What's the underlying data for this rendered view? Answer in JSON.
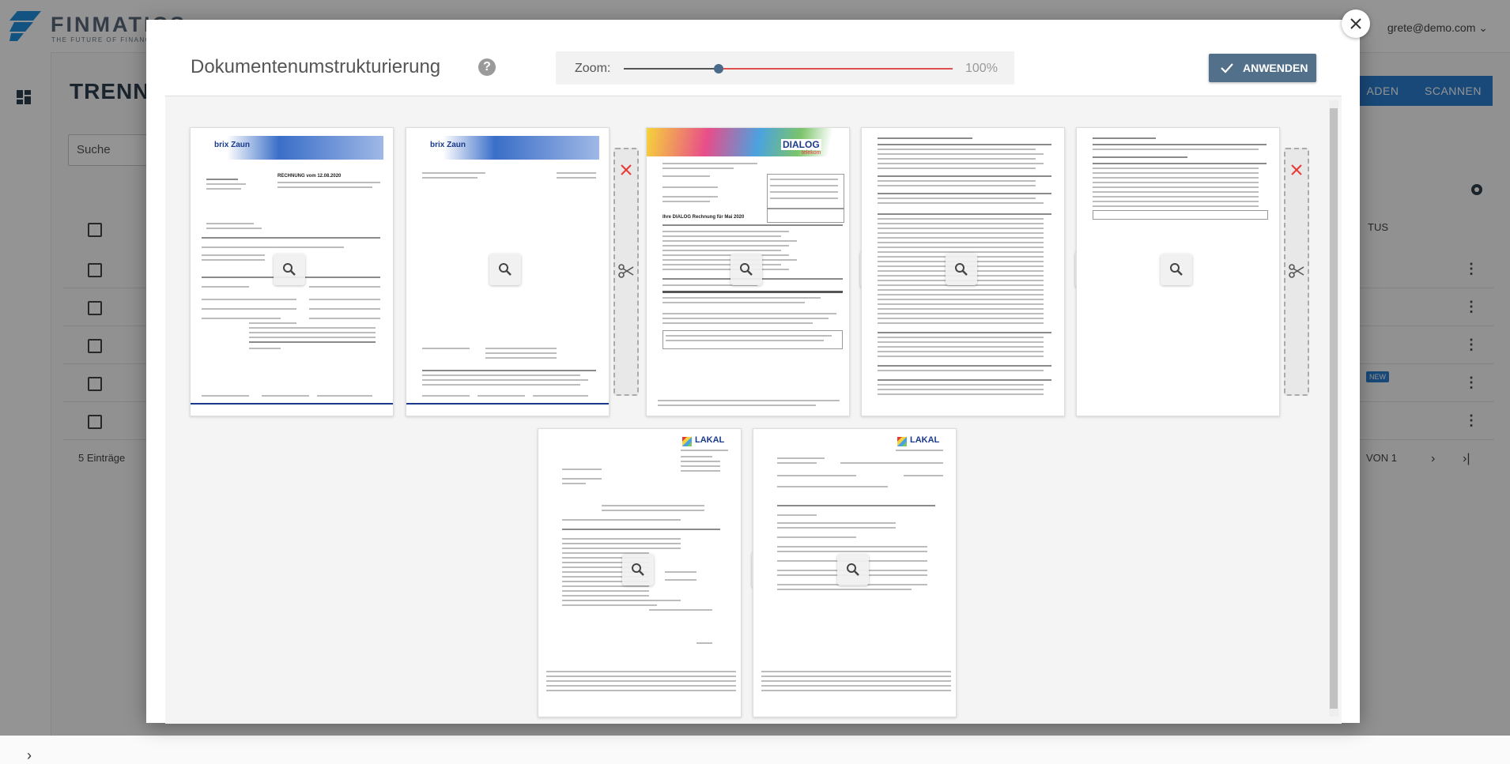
{
  "app": {
    "logo_text": "FINMATICS",
    "logo_tagline": "THE FUTURE OF FINANCE",
    "user_email": "grete@demo.com",
    "page_title": "TRENN",
    "search_placeholder": "Suche",
    "upload_button": "ADEN",
    "scan_button": "SCANNEN",
    "status_header": "TUS",
    "new_badge": "NEW",
    "entries_count": "5 Einträge",
    "pager_text": "VON 1",
    "colors": {
      "primary": "#2a7fd1",
      "header_text": "#2e3e4e"
    }
  },
  "modal": {
    "title": "Dokumentenumstrukturierung",
    "help_icon": "question-icon",
    "zoom": {
      "label": "Zoom:",
      "value_text": "100%",
      "level_fraction": 0.28
    },
    "apply_label": "ANWENDEN",
    "close_icon": "close-icon",
    "colors": {
      "apply_bg": "#53708a",
      "zoom_active": "#e05050",
      "remove": "#e53935"
    }
  },
  "documents": {
    "doc1_logo": "brix Zaun",
    "doc1_heading": "RECHNUNG vom 12.08.2020",
    "doc2_logo": "brix Zaun",
    "doc3_logo_a": "DIALOG",
    "doc3_logo_b": "telekom",
    "doc3_heading": "Ihre DIALOG Rechnung für Mai 2020",
    "doc6_logo": "LAKAL",
    "doc7_logo": "LAKAL"
  }
}
